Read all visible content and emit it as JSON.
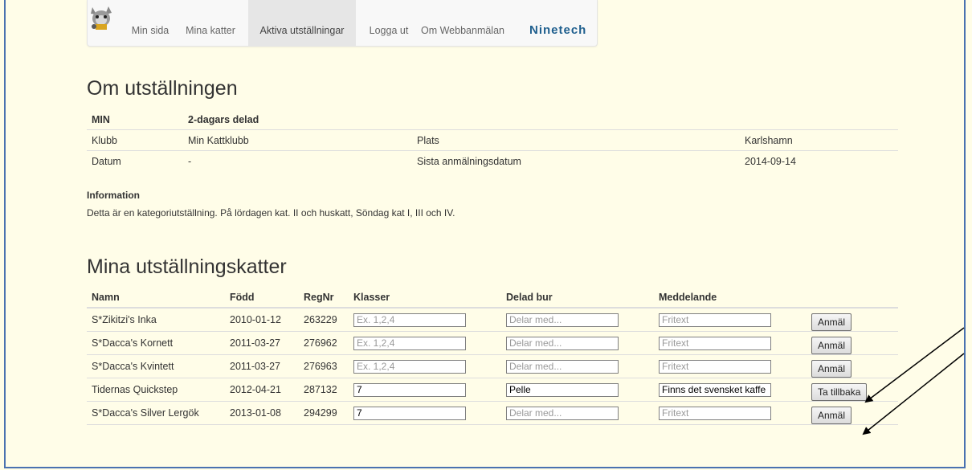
{
  "nav": {
    "items": [
      "Min sida",
      "Mina katter",
      "Aktiva utställningar",
      "Logga ut",
      "Om Webbanmälan"
    ],
    "brand": "Ninetech"
  },
  "about": {
    "title": "Om utställningen",
    "header": [
      "MIN",
      "2-dagars delad"
    ],
    "rows": [
      [
        "Klubb",
        "Min Kattklubb",
        "Plats",
        "Karlshamn"
      ],
      [
        "Datum",
        "-",
        "Sista anmälningsdatum",
        "2014-09-14"
      ]
    ],
    "info_label": "Information",
    "info_text": "Detta är en kategoriutställning. På lördagen kat. II och huskatt, Söndag kat I, III och IV."
  },
  "cats": {
    "title": "Mina utställningskatter",
    "columns": [
      "Namn",
      "Född",
      "RegNr",
      "Klasser",
      "Delad bur",
      "Meddelande"
    ],
    "placeholders": {
      "klasser": "Ex. 1,2,4",
      "bur": "Delar med...",
      "meddelande": "Fritext"
    },
    "rows": [
      {
        "name": "S*Zikitzi's Inka",
        "born": "2010-01-12",
        "reg": "263229",
        "klasser": "",
        "bur": "",
        "msg": "",
        "button": "Anmäl"
      },
      {
        "name": "S*Dacca's Kornett",
        "born": "2011-03-27",
        "reg": "276962",
        "klasser": "",
        "bur": "",
        "msg": "",
        "button": "Anmäl"
      },
      {
        "name": "S*Dacca's Kvintett",
        "born": "2011-03-27",
        "reg": "276963",
        "klasser": "",
        "bur": "",
        "msg": "",
        "button": "Anmäl"
      },
      {
        "name": "Tidernas Quickstep",
        "born": "2012-04-21",
        "reg": "287132",
        "klasser": "7",
        "bur": "Pelle",
        "msg": "Finns det svensket kaffe",
        "button": "Ta tillbaka"
      },
      {
        "name": "S*Dacca's Silver Lergök",
        "born": "2013-01-08",
        "reg": "294299",
        "klasser": "7",
        "bur": "",
        "msg": "",
        "button": "Anmäl"
      }
    ]
  }
}
